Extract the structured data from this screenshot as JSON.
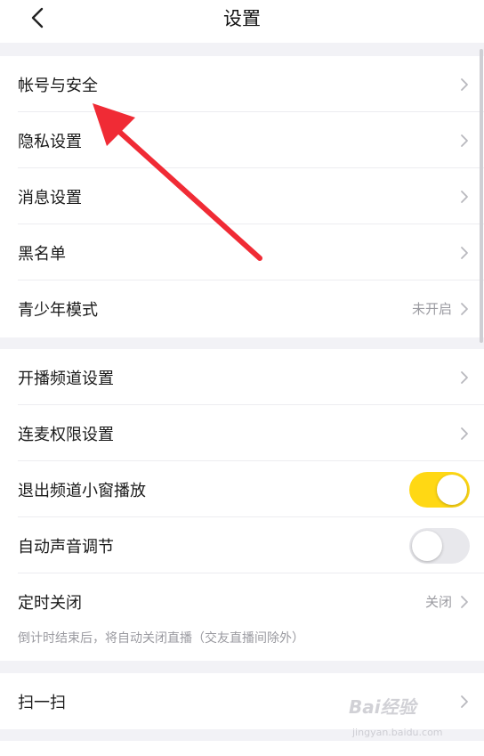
{
  "header": {
    "title": "设置"
  },
  "group1": {
    "items": [
      {
        "label": "帐号与安全"
      },
      {
        "label": "隐私设置"
      },
      {
        "label": "消息设置"
      },
      {
        "label": "黑名单"
      },
      {
        "label": "青少年模式",
        "value": "未开启"
      }
    ]
  },
  "group2": {
    "items": [
      {
        "label": "开播频道设置"
      },
      {
        "label": "连麦权限设置"
      },
      {
        "label": "退出频道小窗播放",
        "toggle": true
      },
      {
        "label": "自动声音调节",
        "toggle": false
      },
      {
        "label": "定时关闭",
        "value": "关闭"
      }
    ],
    "note": "倒计时结束后，将自动关闭直播（交友直播间除外）"
  },
  "group3": {
    "items": [
      {
        "label": "扫一扫"
      }
    ]
  },
  "colors": {
    "accent": "#ffd814",
    "arrow": "#f02b35"
  },
  "watermark": {
    "text": "Bai经验",
    "sub": "jingyan.baidu.com"
  }
}
